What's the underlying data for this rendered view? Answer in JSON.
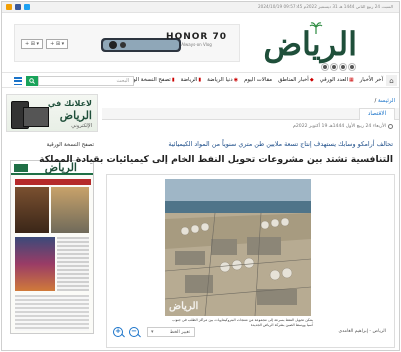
{
  "topbar": {
    "date": "السبت 24 ربيع الثاني 1444 هـ 31 ديسمبر 2022م 09:57:45 2024/10/19",
    "social_icons": [
      "rss-icon",
      "facebook-icon",
      "twitter-icon"
    ],
    "colors": {
      "rss": "#f29f05",
      "facebook": "#3b5998",
      "twitter": "#1da1f2"
    }
  },
  "header": {
    "logo_text": "الرياض",
    "ad": {
      "brand": "HONOR 70",
      "brand_sub": "Always-on Vlog",
      "select_1": "+ ⊞ ▾",
      "select_2": "+ ⊞ ▾"
    },
    "lang_dots": 4
  },
  "nav": {
    "items": [
      {
        "label": "آخر الأخبار",
        "icon": ""
      },
      {
        "label": "العدد الورقي",
        "icon": "▦"
      },
      {
        "label": "أخبار المناطق",
        "icon": "◆"
      },
      {
        "label": "مقالات اليوم",
        "icon": ""
      },
      {
        "label": "دنيا الرياضة",
        "icon": "◉"
      },
      {
        "label": "الرياضة",
        "icon": "▮"
      },
      {
        "label": "تصفح النسخة الورقية",
        "icon": "▮"
      }
    ],
    "search_placeholder": "البحث"
  },
  "sidebar": {
    "ad": {
      "line1": "لاعلانك في",
      "line2": "الرياض",
      "line3": "الإلكتروني"
    },
    "paper_title": "تصفح النسخة الورقية",
    "paper_masthead": "الرياض"
  },
  "main": {
    "breadcrumb_home": "الرئيسة",
    "breadcrumb_sep": " / ",
    "tab": "الاقتصاد",
    "date": "الأربعاء 24 ربيع الأول 1444هـ 19 أكتوبر 2022م",
    "subtitle": "تحالف أرامكو وسابك يستهدف إنتاج تسعة ملايين طن متري سنوياً من المواد الكيميائية",
    "headline": "التنافسية تشتد بين مشروعات تحويل النفط الخام إلى كيميائيات بقيادة المملكة",
    "photo_watermark": "الرياض",
    "caption": "يمكن تحويل النفط بسرعة إلى مجموعة من منتجات البتروكيماويات بين مراكز الطلب في جنوب آسيا ووسط الصين بشركة الرياض الجديدة",
    "author": "الرياض - إبراهيم الغامدي",
    "size_select": "تغيير الخط",
    "zoom_in_symbol": "+",
    "zoom_out_symbol": "−"
  }
}
